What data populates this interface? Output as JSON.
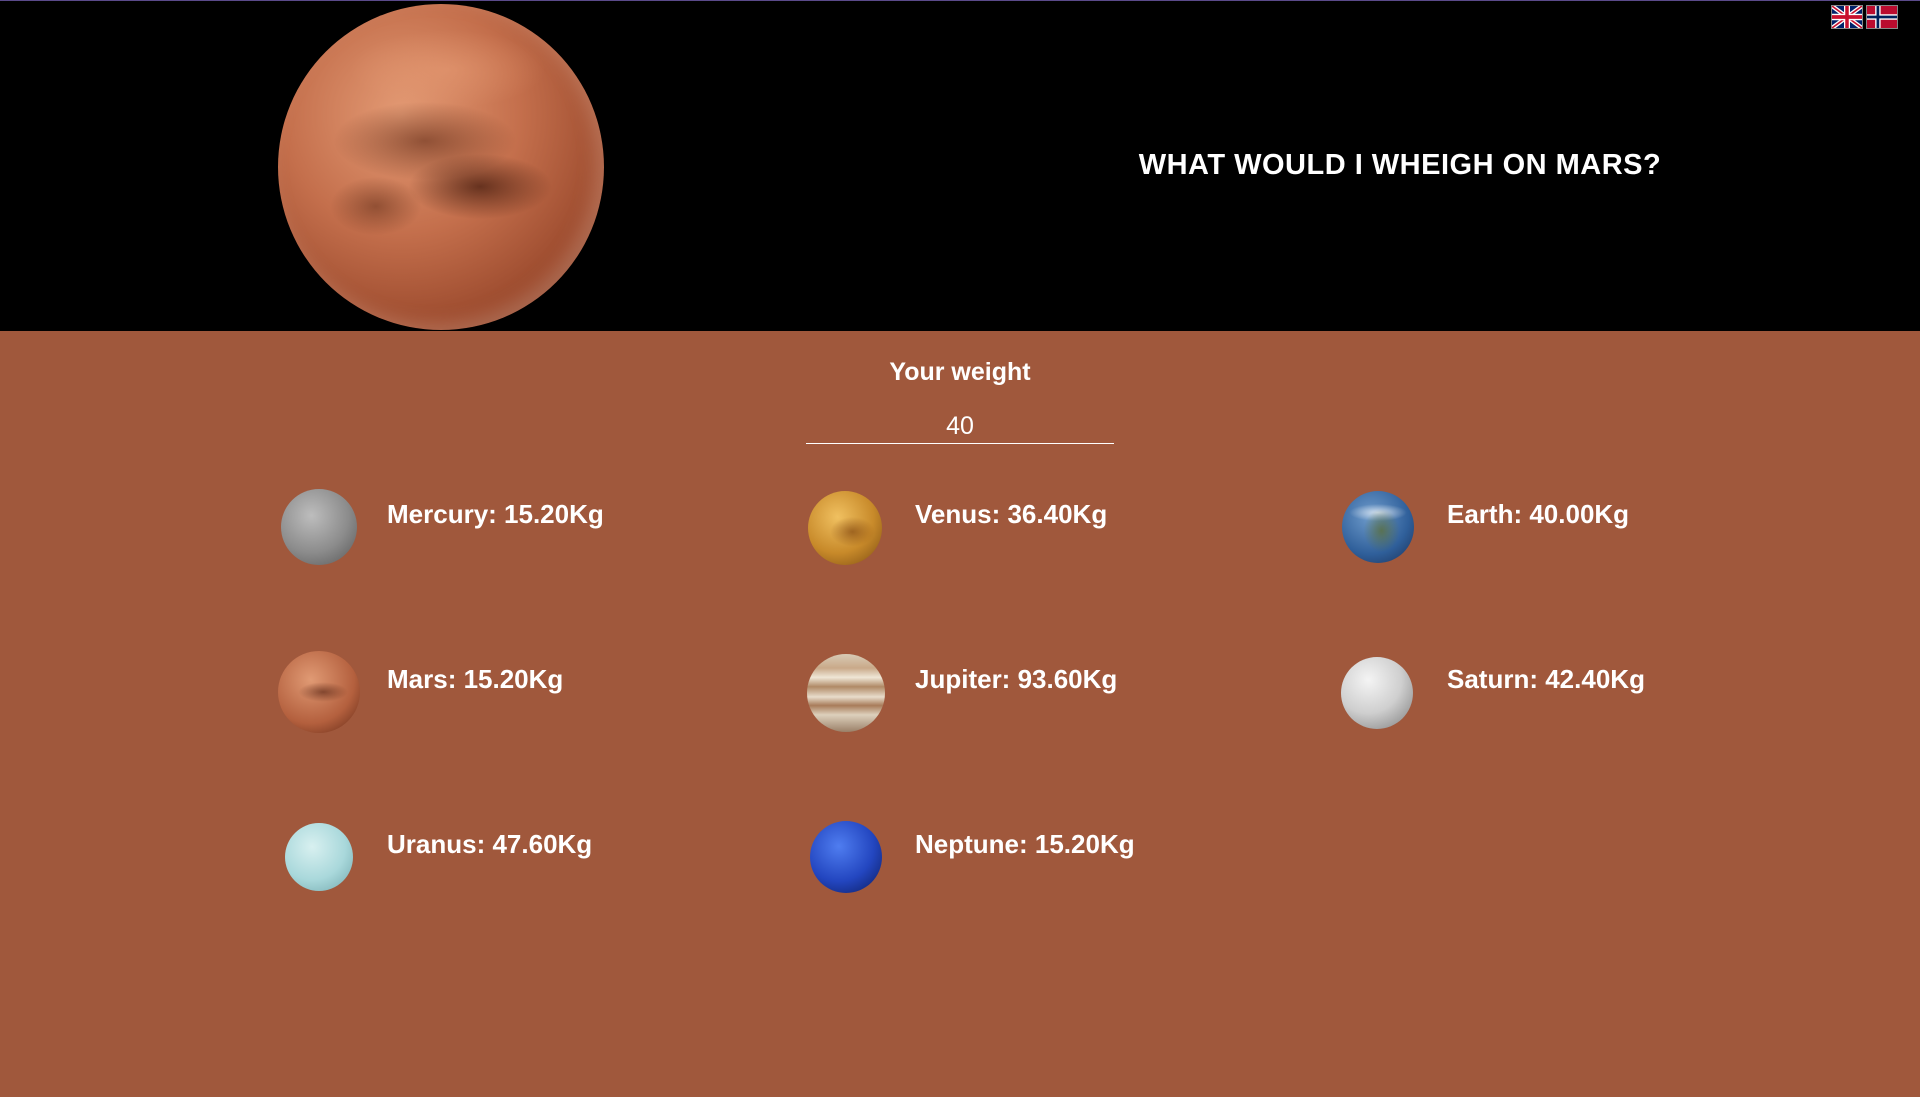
{
  "header": {
    "title": "WHAT WOULD I WHEIGH ON MARS?",
    "hero_icon": "mars-planet-image",
    "languages": [
      {
        "icon": "uk-flag-icon",
        "code": "en"
      },
      {
        "icon": "norway-flag-icon",
        "code": "no"
      }
    ]
  },
  "weight": {
    "label": "Your weight",
    "value": "40"
  },
  "planets": [
    {
      "icon": "mercury-icon",
      "text": "Mercury: 15.20Kg"
    },
    {
      "icon": "venus-icon",
      "text": "Venus: 36.40Kg"
    },
    {
      "icon": "earth-icon",
      "text": "Earth: 40.00Kg"
    },
    {
      "icon": "mars-icon",
      "text": "Mars: 15.20Kg"
    },
    {
      "icon": "jupiter-icon",
      "text": "Jupiter: 93.60Kg"
    },
    {
      "icon": "saturn-icon",
      "text": "Saturn: 42.40Kg"
    },
    {
      "icon": "uranus-icon",
      "text": "Uranus: 47.60Kg"
    },
    {
      "icon": "neptune-icon",
      "text": "Neptune: 15.20Kg"
    }
  ],
  "colors": {
    "header_bg": "#000000",
    "page_bg": "#a0583c",
    "text": "#ffffff"
  }
}
